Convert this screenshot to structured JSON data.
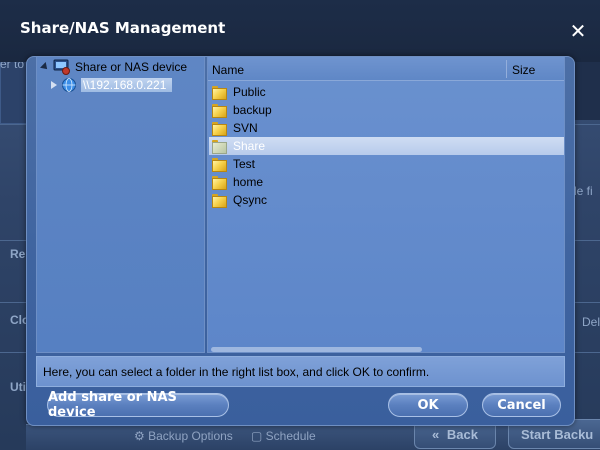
{
  "dialog": {
    "title": "Share/NAS Management",
    "close_icon": "close-icon"
  },
  "tree": {
    "root_label": "Share or NAS device",
    "device_label": "\\\\192.168.0.221"
  },
  "list": {
    "col_name": "Name",
    "col_size": "Size",
    "items": [
      {
        "name": "Public",
        "selected": false
      },
      {
        "name": "backup",
        "selected": false
      },
      {
        "name": "SVN",
        "selected": false
      },
      {
        "name": "Share",
        "selected": true
      },
      {
        "name": "Test",
        "selected": false
      },
      {
        "name": "home",
        "selected": false
      },
      {
        "name": "Qsync",
        "selected": false
      }
    ]
  },
  "hint": "Here, you can select a folder in the right list box, and click OK to confirm.",
  "buttons": {
    "add": "Add share or NAS device",
    "ok": "OK",
    "cancel": "Cancel"
  },
  "background": {
    "left_fragments": [
      "er to",
      "Re",
      "Clo",
      "Uti"
    ],
    "right_fragments": [
      "de fi",
      "Del"
    ],
    "backup_options": "Backup Options",
    "schedule": "Schedule",
    "back": "Back",
    "start_backup": "Start Backu"
  }
}
